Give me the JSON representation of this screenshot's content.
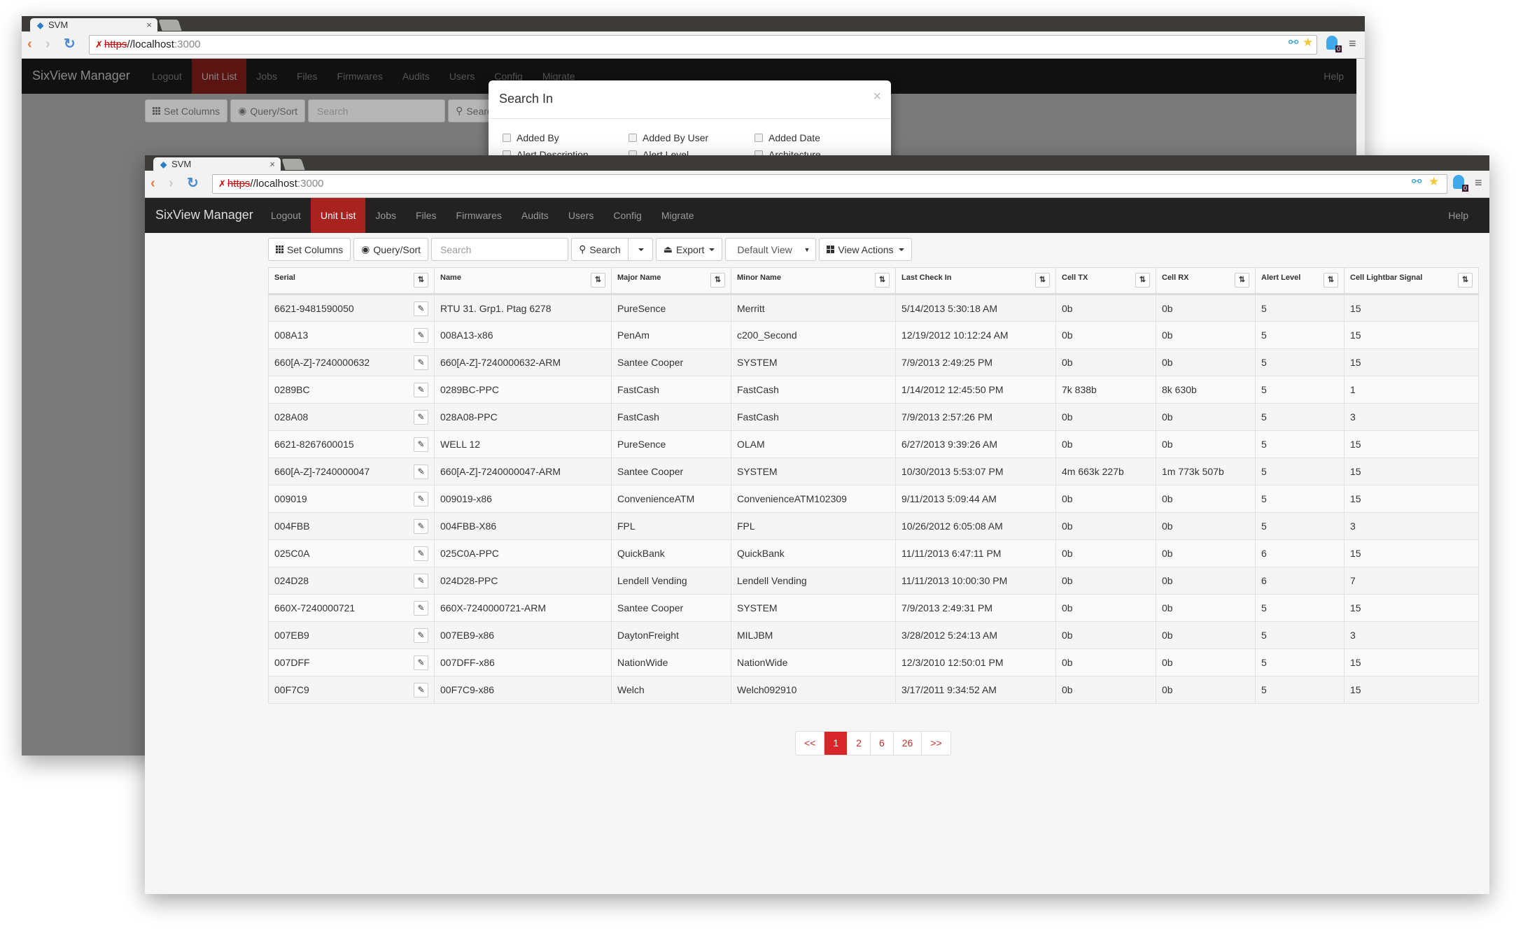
{
  "browser": {
    "tab_title": "SVM",
    "tab_close": "×",
    "url_scheme": "https",
    "url_host": "//localhost",
    "url_port": ":3000",
    "extension_badge": "0"
  },
  "app": {
    "brand": "SixView Manager",
    "nav": [
      {
        "label": "Logout",
        "active": false
      },
      {
        "label": "Unit List",
        "active": true
      },
      {
        "label": "Jobs",
        "active": false
      },
      {
        "label": "Files",
        "active": false
      },
      {
        "label": "Firmwares",
        "active": false
      },
      {
        "label": "Audits",
        "active": false
      },
      {
        "label": "Users",
        "active": false
      },
      {
        "label": "Config",
        "active": false
      },
      {
        "label": "Migrate",
        "active": false
      }
    ],
    "help": "Help",
    "accent_color": "#a8231f"
  },
  "toolbar": {
    "set_columns": "Set Columns",
    "query_sort": "Query/Sort",
    "search_placeholder": "Search",
    "search_button": "Search",
    "export": "Export",
    "view_select": "Default View",
    "view_actions": "View Actions"
  },
  "table": {
    "columns": [
      "Serial",
      "Name",
      "Major Name",
      "Minor Name",
      "Last Check In",
      "Cell TX",
      "Cell RX",
      "Alert Level",
      "Cell Lightbar Signal"
    ],
    "rows": [
      [
        "6621-9481590050",
        "RTU 31. Grp1. Ptag 6278",
        "PureSence",
        "Merritt",
        "5/14/2013 5:30:18 AM",
        "0b",
        "0b",
        "5",
        "15"
      ],
      [
        "008A13",
        "008A13-x86",
        "PenAm",
        "c200_Second",
        "12/19/2012 10:12:24 AM",
        "0b",
        "0b",
        "5",
        "15"
      ],
      [
        "660[A-Z]-7240000632",
        "660[A-Z]-7240000632-ARM",
        "Santee Cooper",
        "SYSTEM",
        "7/9/2013 2:49:25 PM",
        "0b",
        "0b",
        "5",
        "15"
      ],
      [
        "0289BC",
        "0289BC-PPC",
        "FastCash",
        "FastCash",
        "1/14/2012 12:45:50 PM",
        "7k 838b",
        "8k 630b",
        "5",
        "1"
      ],
      [
        "028A08",
        "028A08-PPC",
        "FastCash",
        "FastCash",
        "7/9/2013 2:57:26 PM",
        "0b",
        "0b",
        "5",
        "3"
      ],
      [
        "6621-8267600015",
        "WELL 12",
        "PureSence",
        "OLAM",
        "6/27/2013 9:39:26 AM",
        "0b",
        "0b",
        "5",
        "15"
      ],
      [
        "660[A-Z]-7240000047",
        "660[A-Z]-7240000047-ARM",
        "Santee Cooper",
        "SYSTEM",
        "10/30/2013 5:53:07 PM",
        "4m 663k 227b",
        "1m 773k 507b",
        "5",
        "15"
      ],
      [
        "009019",
        "009019-x86",
        "ConvenienceATM",
        "ConvenienceATM102309",
        "9/11/2013 5:09:44 AM",
        "0b",
        "0b",
        "5",
        "15"
      ],
      [
        "004FBB",
        "004FBB-X86",
        "FPL",
        "FPL",
        "10/26/2012 6:05:08 AM",
        "0b",
        "0b",
        "5",
        "3"
      ],
      [
        "025C0A",
        "025C0A-PPC",
        "QuickBank",
        "QuickBank",
        "11/11/2013 6:47:11 PM",
        "0b",
        "0b",
        "6",
        "15"
      ],
      [
        "024D28",
        "024D28-PPC",
        "Lendell Vending",
        "Lendell Vending",
        "11/11/2013 10:00:30 PM",
        "0b",
        "0b",
        "6",
        "7"
      ],
      [
        "660X-7240000721",
        "660X-7240000721-ARM",
        "Santee Cooper",
        "SYSTEM",
        "7/9/2013 2:49:31 PM",
        "0b",
        "0b",
        "5",
        "15"
      ],
      [
        "007EB9",
        "007EB9-x86",
        "DaytonFreight",
        "MILJBM",
        "3/28/2012 5:24:13 AM",
        "0b",
        "0b",
        "5",
        "3"
      ],
      [
        "007DFF",
        "007DFF-x86",
        "NationWide",
        "NationWide",
        "12/3/2010 12:50:01 PM",
        "0b",
        "0b",
        "5",
        "15"
      ],
      [
        "00F7C9",
        "00F7C9-x86",
        "Welch",
        "Welch092910",
        "3/17/2011 9:34:52 AM",
        "0b",
        "0b",
        "5",
        "15"
      ]
    ]
  },
  "pagination": {
    "pages": [
      "<<",
      "1",
      "2",
      "6",
      "26",
      ">>"
    ],
    "current": "1"
  },
  "modal": {
    "title": "Search In",
    "close": "×",
    "options": [
      "Added By",
      "Added By User",
      "Added Date",
      "Alert Description",
      "Alert Level",
      "Architecture"
    ]
  }
}
